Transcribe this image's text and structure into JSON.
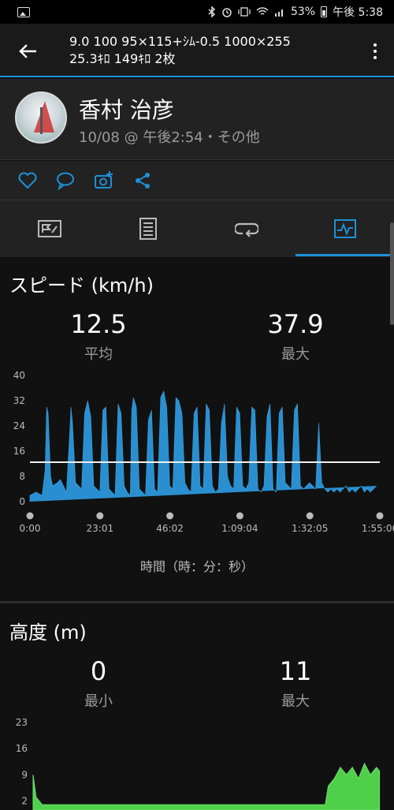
{
  "status_bar": {
    "battery": "53%",
    "time": "午後 5:38",
    "icons": [
      "image-icon",
      "bluetooth-icon",
      "alarm-icon",
      "vibrate-icon",
      "wifi-icon",
      "signal-icon",
      "battery-icon"
    ]
  },
  "app_bar": {
    "title_line1": "9.0 100 95×115+ｼﾑ-0.5 1000×255",
    "title_line2": "25.3ｷﾛ 149ｷﾛ 2枚"
  },
  "profile": {
    "name": "香村 治彦",
    "meta": "10/08 @ 午後2:54・その他"
  },
  "actions": [
    "like-icon",
    "comment-icon",
    "add-photo-icon",
    "share-icon"
  ],
  "tabs": [
    {
      "name": "tab-summary",
      "icon": "flag-card-icon"
    },
    {
      "name": "tab-details",
      "icon": "document-icon"
    },
    {
      "name": "tab-laps",
      "icon": "loop-icon"
    },
    {
      "name": "tab-charts",
      "icon": "chart-icon",
      "active": true
    }
  ],
  "colors": {
    "accent": "#1e90d6",
    "speed_fill": "#2a8fd0",
    "elevation_fill": "#4fd04a",
    "background": "#111111",
    "panel": "#222222"
  },
  "speed": {
    "title": "スピード (km/h)",
    "avg_value": "12.5",
    "avg_label": "平均",
    "max_value": "37.9",
    "max_label": "最大",
    "axis_title": "時間（時：分：秒）"
  },
  "elevation": {
    "title": "高度 (m)",
    "min_value": "0",
    "min_label": "最小",
    "max_value": "11",
    "max_label": "最大"
  },
  "chart_data": [
    {
      "type": "area",
      "title": "スピード (km/h)",
      "xlabel": "時間（時：分：秒）",
      "ylabel": "",
      "ylim": [
        0,
        40
      ],
      "yticks": [
        0,
        8,
        16,
        24,
        32,
        40
      ],
      "xticks": [
        "0:00",
        "23:01",
        "46:02",
        "1:09:04",
        "1:32:05",
        "1:55:06"
      ],
      "xlim_minutes": [
        0,
        115.1
      ],
      "average_line": 12.5,
      "series": [
        {
          "minutes": [
            0,
            2,
            4,
            5,
            5.5,
            6,
            6.8,
            7.5,
            9,
            10,
            12,
            13,
            13.5,
            14,
            15,
            16,
            17,
            18,
            19,
            20,
            21,
            22,
            23,
            24,
            25,
            26,
            27,
            28,
            29,
            30,
            31,
            32,
            33,
            33.5,
            34,
            35,
            36,
            37,
            38,
            39,
            40,
            41,
            42,
            43,
            44,
            45,
            46,
            47,
            48,
            49,
            50,
            51,
            52,
            53,
            54,
            55,
            56,
            57,
            58,
            59,
            60,
            61,
            62,
            63,
            64,
            65,
            66,
            67,
            68,
            69,
            70,
            71,
            72,
            73,
            74,
            75,
            76,
            77,
            78,
            79,
            80,
            81,
            82,
            83,
            84,
            85,
            86,
            87,
            88,
            89,
            90,
            91,
            92,
            93,
            94,
            95,
            96,
            97,
            98,
            99,
            100,
            101,
            102,
            103,
            104,
            105,
            106,
            107,
            108,
            109,
            110,
            111,
            112,
            113,
            114,
            115
          ],
          "values": [
            2,
            3,
            2,
            10,
            30,
            28,
            8,
            5,
            6,
            7,
            3,
            20,
            30,
            25,
            6,
            5,
            4,
            28,
            32,
            27,
            5,
            4,
            3,
            29,
            30,
            4,
            3,
            2,
            31,
            28,
            5,
            3,
            2,
            29,
            33,
            30,
            4,
            3,
            2,
            26,
            29,
            4,
            3,
            33,
            35,
            30,
            5,
            4,
            33,
            32,
            28,
            6,
            4,
            3,
            28,
            30,
            5,
            4,
            31,
            29,
            5,
            3,
            4,
            25,
            31,
            8,
            5,
            4,
            30,
            28,
            5,
            4,
            6,
            30,
            29,
            4,
            3,
            5,
            27,
            31,
            4,
            3,
            28,
            30,
            6,
            5,
            4,
            29,
            31,
            5,
            4,
            5,
            6,
            5,
            4,
            25,
            6,
            4,
            3,
            4,
            3,
            4,
            3,
            4,
            5,
            3,
            4,
            3,
            4,
            5,
            3,
            4,
            3,
            4,
            5
          ]
        }
      ]
    },
    {
      "type": "area",
      "title": "高度 (m)",
      "ylim": [
        0,
        23
      ],
      "yticks": [
        2,
        9,
        16,
        23
      ],
      "series": [
        {
          "minutes": [
            0,
            1,
            2,
            3,
            5,
            10,
            20,
            40,
            60,
            80,
            90,
            95,
            97,
            98,
            100,
            102,
            104,
            106,
            108,
            110,
            112,
            114,
            115
          ],
          "values": [
            9,
            3,
            2,
            1,
            1,
            1,
            1,
            1,
            1,
            1,
            1,
            1,
            1,
            6,
            8,
            11,
            9,
            11,
            8,
            12,
            9,
            11,
            10
          ]
        }
      ]
    }
  ]
}
